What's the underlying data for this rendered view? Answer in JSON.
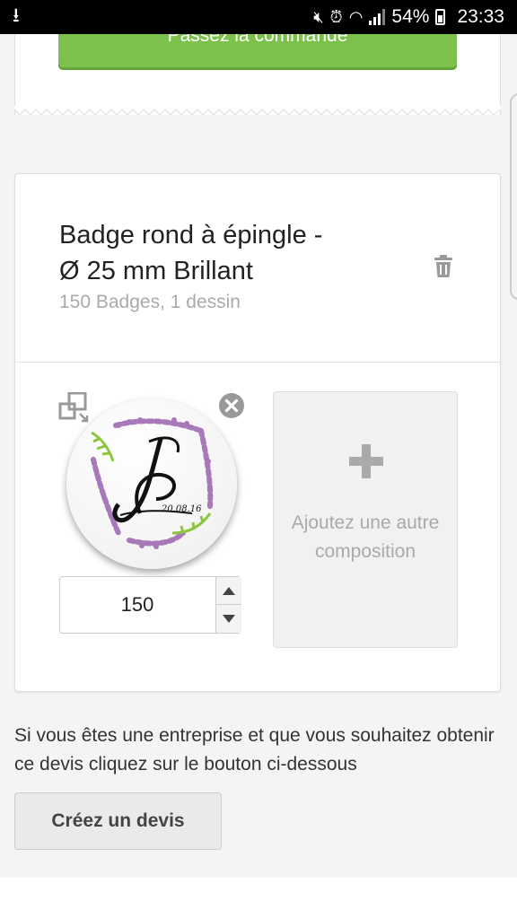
{
  "statusbar": {
    "download_icon": "download-icon",
    "battery_pct": "54%",
    "time": "23:33"
  },
  "order": {
    "button_label": "Passez la commande"
  },
  "product": {
    "title_line1": "Badge rond à épingle -",
    "title_line2": "Ø 25 mm Brillant",
    "subtitle": "150 Badges, 1 dessin",
    "badge_text": "20.08.16",
    "quantity": "150"
  },
  "add_composition": {
    "label": "Ajoutez une autre composition"
  },
  "info_text": "Si vous êtes une entreprise et que vous souhaitez obtenir ce devis cliquez sur le bouton ci-dessous",
  "devis": {
    "button_label": "Créez un devis"
  },
  "colors": {
    "accent_green": "#7cc14b",
    "badge_green": "#8cc63f",
    "badge_purple": "#a879b8"
  }
}
